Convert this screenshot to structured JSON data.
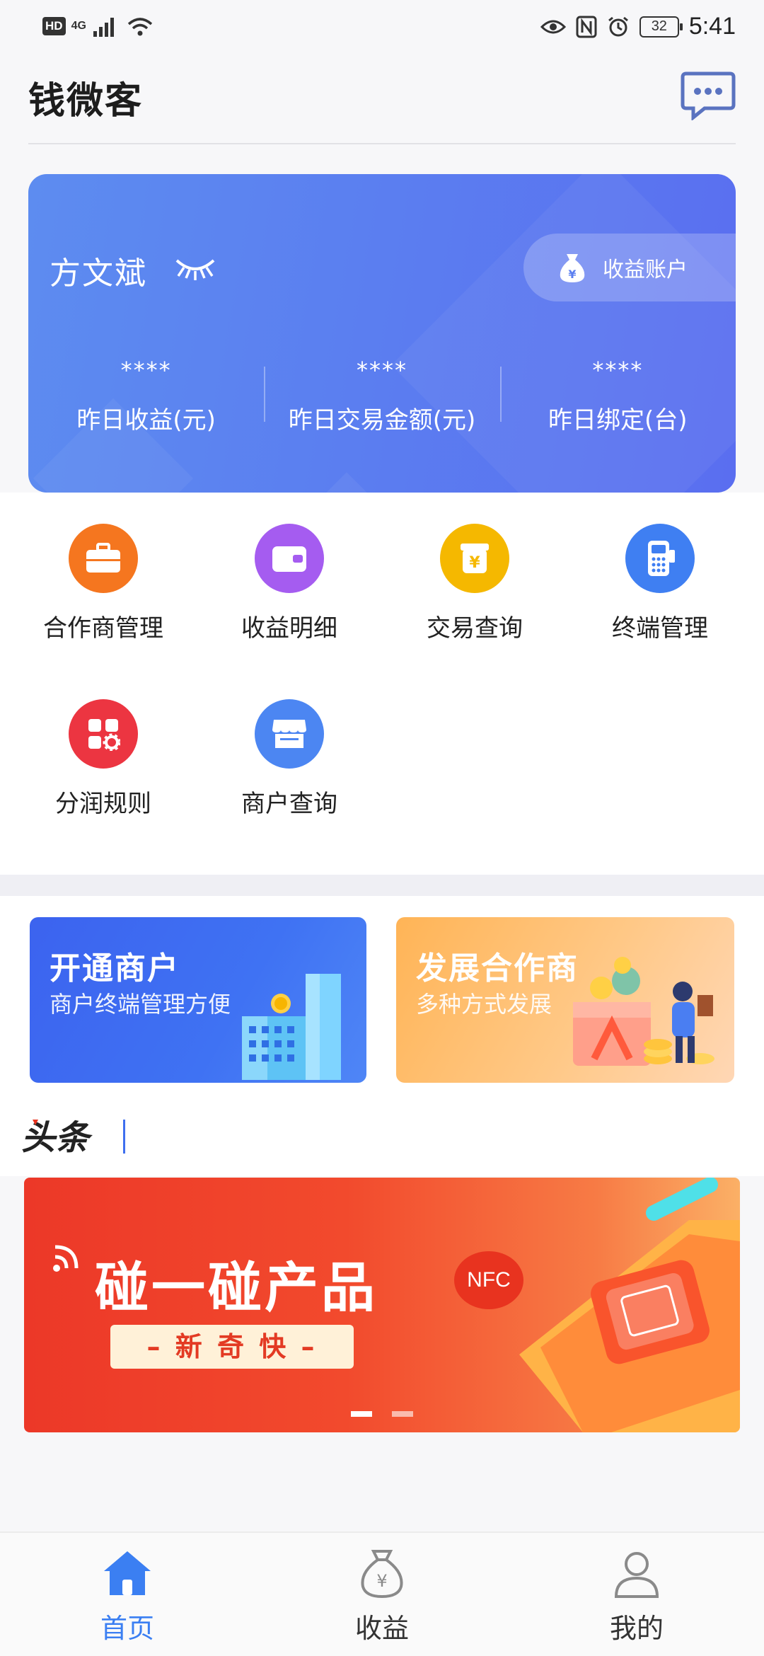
{
  "status_bar": {
    "left_badge": "HD",
    "network": "4G",
    "battery": "32",
    "time": "5:41"
  },
  "header": {
    "title": "钱微客",
    "message_icon": "chat-bubble-icon"
  },
  "summary": {
    "user_name": "方文斌",
    "account_button": "收益账户",
    "stats": [
      {
        "value": "****",
        "label": "昨日收益(元)"
      },
      {
        "value": "****",
        "label": "昨日交易金额(元)"
      },
      {
        "value": "****",
        "label": "昨日绑定(台)"
      }
    ]
  },
  "menu": [
    {
      "label": "合作商管理",
      "icon": "briefcase-icon",
      "color": "#f5761f"
    },
    {
      "label": "收益明细",
      "icon": "wallet-icon",
      "color": "#a55cf0"
    },
    {
      "label": "交易查询",
      "icon": "yen-bag-icon",
      "color": "#f5b800"
    },
    {
      "label": "终端管理",
      "icon": "pos-terminal-icon",
      "color": "#3f7ff2"
    },
    {
      "label": "分润规则",
      "icon": "grid-gear-icon",
      "color": "#ec3541"
    },
    {
      "label": "商户查询",
      "icon": "store-icon",
      "color": "#4c86f2"
    }
  ],
  "promos": {
    "merchant": {
      "title": "开通商户",
      "subtitle": "商户终端管理方便"
    },
    "partner": {
      "title": "发展合作商",
      "subtitle": "多种方式发展"
    }
  },
  "news": {
    "brand": "头条"
  },
  "carousel": {
    "title": "碰一碰产品",
    "tag": "– 新 奇 快 –",
    "badge": "NFC",
    "slide_count": 2,
    "active_index": 0
  },
  "bottom_nav": [
    {
      "label": "首页",
      "icon": "home-icon",
      "active": true
    },
    {
      "label": "收益",
      "icon": "money-bag-icon",
      "active": false
    },
    {
      "label": "我的",
      "icon": "user-icon",
      "active": false
    }
  ],
  "colors": {
    "nav_active": "#3b7ff2",
    "nav_inactive": "#333333",
    "card_gradient_start": "#5d8cf0",
    "card_gradient_end": "#5a6ef0"
  }
}
